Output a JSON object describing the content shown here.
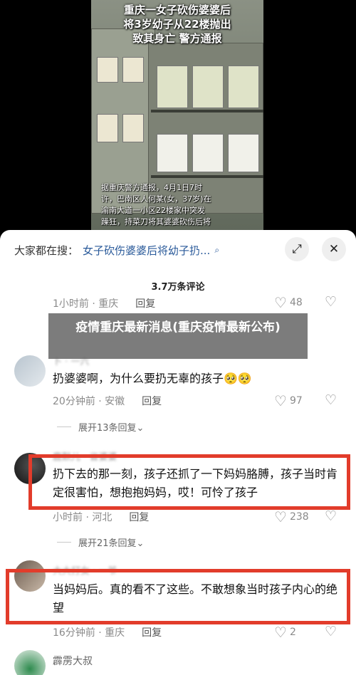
{
  "video": {
    "title_lines": [
      "重庆一女子砍伤婆婆后",
      "将3岁幼子从22楼抛出",
      "致其身亡 警方通报"
    ],
    "subtitle_lines": [
      "据重庆警方通报，4月1日7时",
      "许，巴南区人何某(女，37岁)在",
      "渝南大道一小区22楼家中突发",
      "躁狂，持菜刀将其婆婆砍伤后将"
    ]
  },
  "search": {
    "label": "大家都在搜：",
    "query": "女子砍伤婆婆后将幼子扔...",
    "icon": "search-icon"
  },
  "buttons": {
    "expand_icon": "⤢",
    "close_icon": "✕"
  },
  "comment_count": "3.7万条评论",
  "comments": [
    {
      "time": "1小时前 · 重庆",
      "reply": "回复",
      "likes": "48"
    },
    {
      "user": "卜 · 一六",
      "text": "扔婆婆啊，为什么要扔无辜的孩子🥺🥺",
      "time": "20分钟前 · 安徽",
      "reply": "回复",
      "likes": "97",
      "expand": "展开13条回复⌄"
    },
    {
      "user": "鹿默儿 · 省婆婆",
      "text": "扔下去的那一刻，孩子还抓了一下妈妈胳膊，孩子当时肯定很害怕，想抱抱妈妈，哎！可怜了孩子",
      "time": "小时前 · 河北",
      "reply": "回复",
      "likes": "238",
      "expand": "展开21条回复⌄"
    },
    {
      "user": "大大打女 · 一爷",
      "text": "当妈妈后。真的看不了这些。不敢想象当时孩子内心的绝望",
      "time": "16分钟前 · 重庆",
      "reply": "回复",
      "likes": "2"
    },
    {
      "user": "霹雳大叔"
    }
  ],
  "overlay_text": "疫情重庆最新消息(重庆疫情最新公布)",
  "colors": {
    "highlight": "#e23c2b",
    "link": "#2a5a9a"
  }
}
